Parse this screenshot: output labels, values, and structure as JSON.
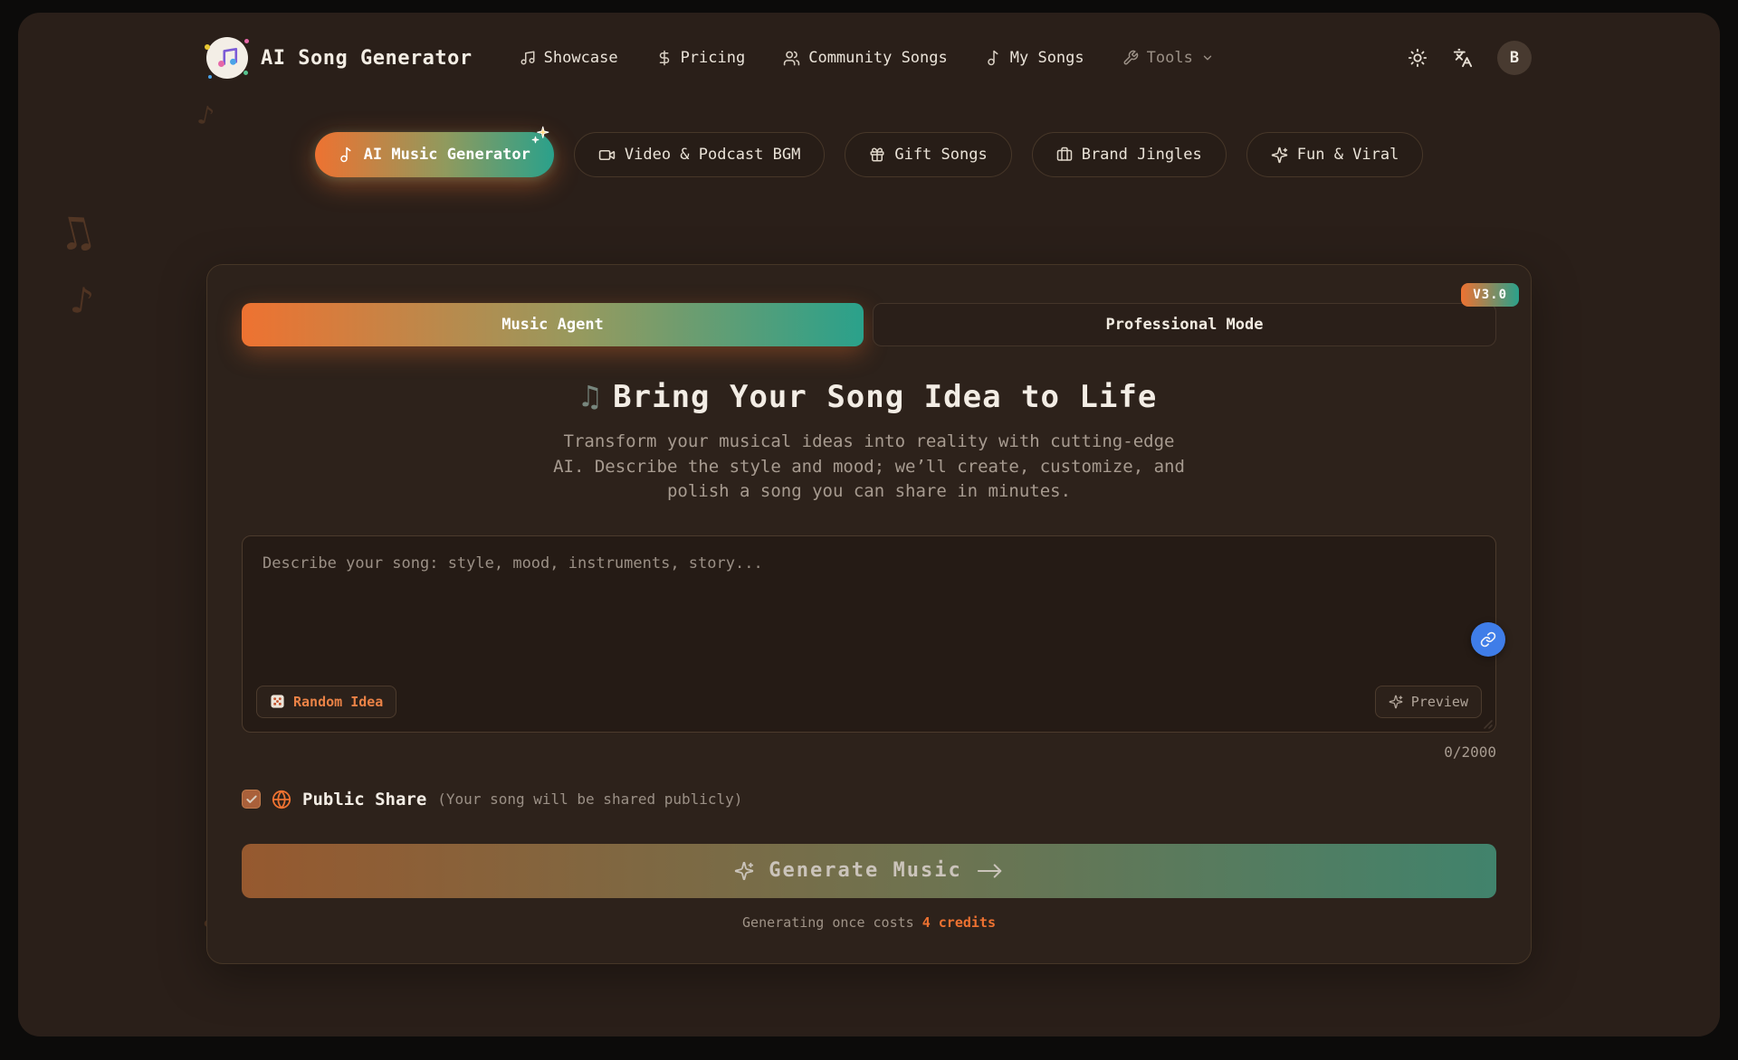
{
  "header": {
    "title": "AI Song Generator",
    "nav": {
      "items": [
        {
          "label": "Showcase"
        },
        {
          "label": "Pricing"
        },
        {
          "label": "Community Songs"
        },
        {
          "label": "My Songs"
        },
        {
          "label": "Tools"
        }
      ]
    },
    "avatar_initial": "B"
  },
  "tabs": {
    "items": [
      {
        "label": "AI Music Generator"
      },
      {
        "label": "Video & Podcast BGM"
      },
      {
        "label": "Gift Songs"
      },
      {
        "label": "Brand Jingles"
      },
      {
        "label": "Fun & Viral"
      }
    ]
  },
  "card": {
    "version_badge": "V3.0",
    "mode_agent": "Music Agent",
    "mode_professional": "Professional Mode",
    "heading_icon": "♫",
    "heading": "Bring Your Song Idea to Life",
    "subtitle_lines": [
      "Transform your musical ideas into reality with cutting-edge",
      "AI. Describe the style and mood; we’ll create, customize, and",
      "polish a song you can share in minutes."
    ],
    "prompt_placeholder": "Describe your song: style, mood, instruments, story...",
    "random_idea_label": "Random Idea",
    "preview_label": "Preview",
    "char_counter": "0/2000",
    "public_share_label": "Public Share",
    "public_share_note": "(Your song will be shared publicly)",
    "generate_label": "Generate Music",
    "credits_prefix": "Generating once costs ",
    "credits_highlight": "4 credits"
  },
  "colors": {
    "accent_orange": "#ee7231",
    "accent_teal": "#2aa18b",
    "link_blue": "#3f7de8"
  },
  "background_notes": [
    "♪",
    "♫",
    "♪",
    "♫",
    "♫"
  ]
}
